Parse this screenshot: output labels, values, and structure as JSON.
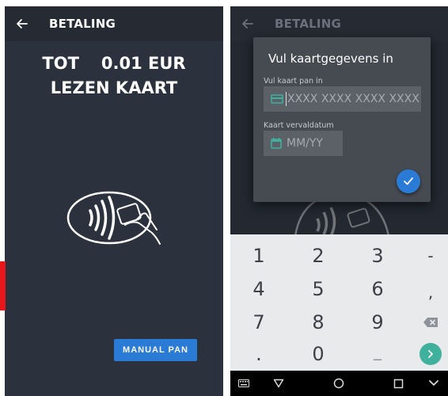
{
  "left_screen": {
    "appbar": {
      "title": "BETALING"
    },
    "amount": {
      "label": "TOT",
      "value": "0.01 EUR"
    },
    "status": "LEZEN KAART",
    "manual_button": "MANUAL PAN"
  },
  "right_screen": {
    "appbar": {
      "title": "BETALING"
    },
    "dialog": {
      "title": "Vul kaartgegevens in",
      "pan_label": "Vul kaart pan in",
      "pan_placeholder": "XXXX XXXX XXXX XXXX",
      "expiry_label": "Kaart vervaldatum",
      "expiry_placeholder": "MM/YY"
    },
    "keypad": [
      [
        "1",
        "2",
        "3",
        "-"
      ],
      [
        "4",
        "5",
        "6",
        ","
      ],
      [
        "7",
        "8",
        "9",
        "backspace"
      ],
      [
        ".",
        "0",
        "_",
        "enter"
      ]
    ]
  },
  "colors": {
    "background": "#2c323d",
    "appbar": "#252a33",
    "primary_button": "#2a7bd6",
    "accent": "#3fb19c",
    "marker": "#e8151b"
  },
  "icons": {
    "back": "arrow-left-icon",
    "contactless": "contactless-card-icon",
    "card": "credit-card-icon",
    "calendar": "calendar-icon",
    "confirm": "check-icon",
    "backspace": "backspace-icon",
    "enter": "chevron-right-icon",
    "nav_keyboard": "keyboard-icon",
    "nav_back": "triangle-back-icon",
    "nav_home": "circle-home-icon",
    "nav_recents": "square-recents-icon",
    "nav_hide": "chevron-down-icon"
  }
}
